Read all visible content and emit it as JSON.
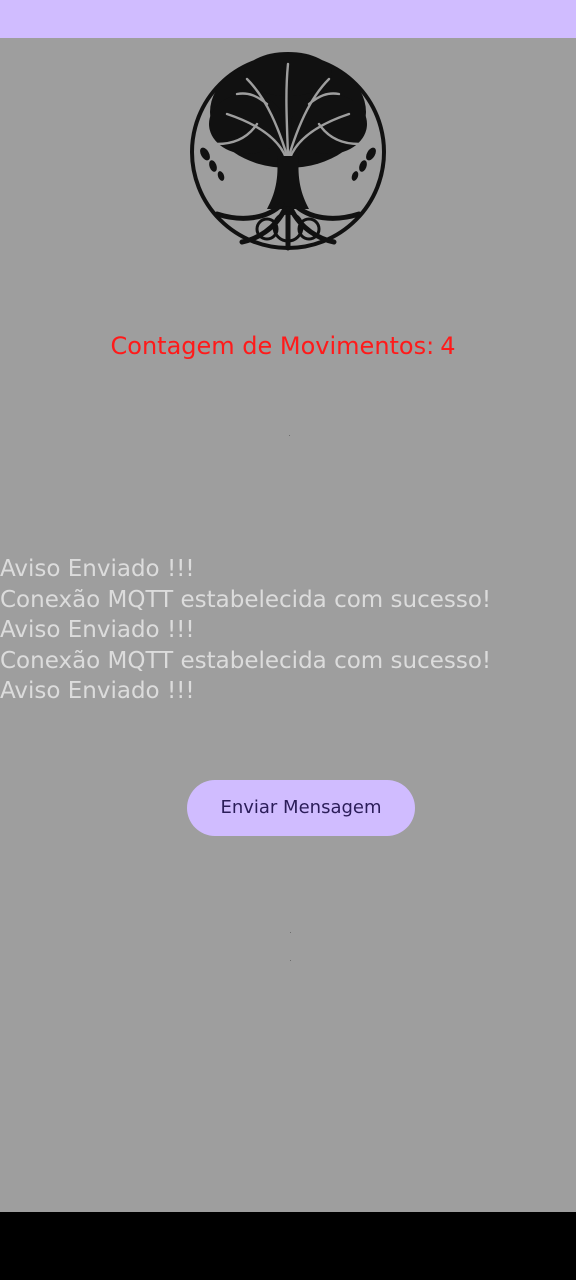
{
  "app": {
    "counter_label": "Contagem de Movimentos:",
    "counter_value": "4",
    "log_lines": [
      "Aviso Enviado !!!",
      "Conexão MQTT estabelecida com sucesso!",
      "Aviso Enviado !!!",
      "Conexão MQTT estabelecida com sucesso!",
      "Aviso Enviado !!!"
    ],
    "send_button_label": "Enviar Mensagem"
  },
  "icons": {
    "logo": "tree-of-life-icon"
  },
  "colors": {
    "status_bar": "#d0bcff",
    "background": "#9e9e9e",
    "counter_text": "#ff1a1a",
    "log_text": "#dcdcdc",
    "button_bg": "#d0bcff",
    "button_text": "#2b1d59",
    "nav_bar": "#000000"
  }
}
